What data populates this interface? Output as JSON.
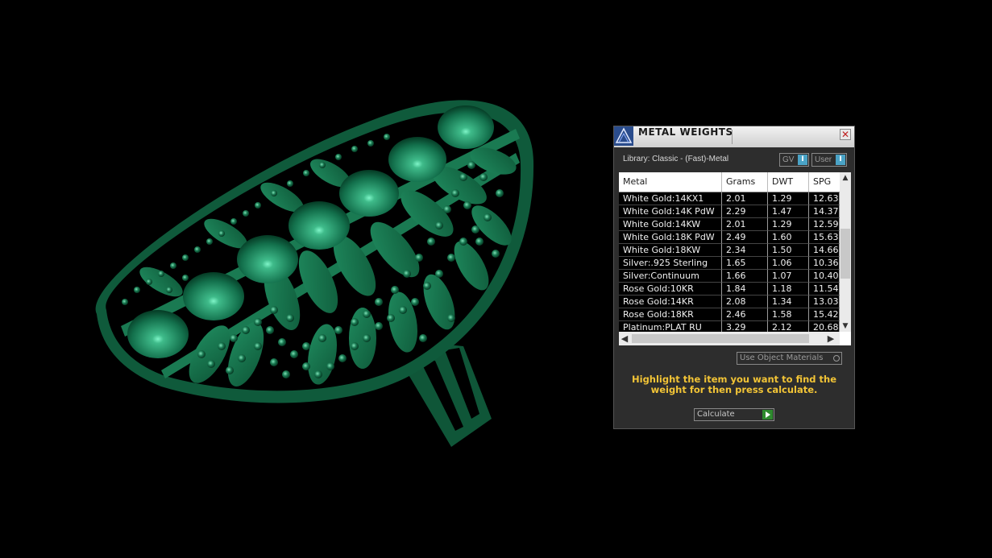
{
  "panel": {
    "title": "METAL WEIGHTS",
    "close_glyph": "✕",
    "library_label": "Library: Classic - (Fast)-Metal",
    "gv_toggle": "GV",
    "user_toggle": "User",
    "toggle_glyph": "I",
    "use_object_materials": "Use Object Materials",
    "instruction": "Highlight the item you want to find the weight for then press calculate.",
    "calculate_label": "Calculate"
  },
  "table": {
    "columns": [
      "Metal",
      "Grams",
      "DWT",
      "SPG"
    ],
    "rows": [
      {
        "metal": "White Gold:14KX1",
        "grams": "2.01",
        "dwt": "1.29",
        "spg": "12.63"
      },
      {
        "metal": "White Gold:14K PdW",
        "grams": "2.29",
        "dwt": "1.47",
        "spg": "14.37"
      },
      {
        "metal": "White Gold:14KW",
        "grams": "2.01",
        "dwt": "1.29",
        "spg": "12.59"
      },
      {
        "metal": "White Gold:18K PdW",
        "grams": "2.49",
        "dwt": "1.60",
        "spg": "15.63"
      },
      {
        "metal": "White Gold:18KW",
        "grams": "2.34",
        "dwt": "1.50",
        "spg": "14.66"
      },
      {
        "metal": "Silver:.925 Sterling",
        "grams": "1.65",
        "dwt": "1.06",
        "spg": "10.36"
      },
      {
        "metal": "Silver:Continuum",
        "grams": "1.66",
        "dwt": "1.07",
        "spg": "10.40"
      },
      {
        "metal": "Rose Gold:10KR",
        "grams": "1.84",
        "dwt": "1.18",
        "spg": "11.54"
      },
      {
        "metal": "Rose Gold:14KR",
        "grams": "2.08",
        "dwt": "1.34",
        "spg": "13.03"
      },
      {
        "metal": "Rose Gold:18KR",
        "grams": "2.46",
        "dwt": "1.58",
        "spg": "15.42"
      },
      {
        "metal": "Platinum:PLAT RU",
        "grams": "3.29",
        "dwt": "2.12",
        "spg": "20.68"
      }
    ]
  },
  "icons": {
    "app": "matrix-logo-icon",
    "close": "close-icon",
    "scroll_up": "▲",
    "scroll_down": "▼",
    "scroll_left": "◀",
    "scroll_right": "▶",
    "calculate": "play-icon"
  },
  "colors": {
    "model_green": "#1a6b4a",
    "instruction_yellow": "#f2c436",
    "toggle_blue": "#4aa3c6"
  }
}
